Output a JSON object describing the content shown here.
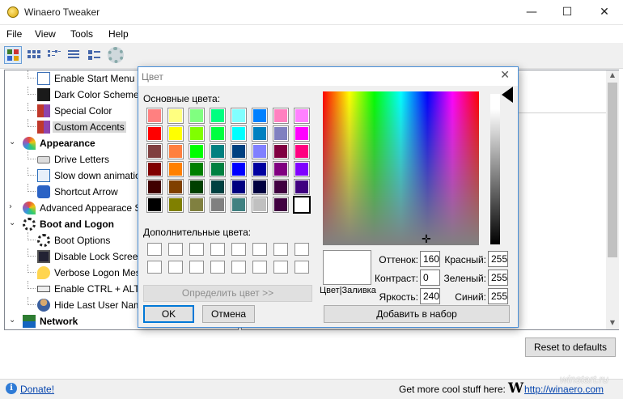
{
  "window": {
    "title": "Winaero Tweaker",
    "minimize_icon": "minimize-icon",
    "maximize_icon": "maximize-icon",
    "close_icon": "close-icon"
  },
  "menu": [
    "File",
    "View",
    "Tools",
    "Help"
  ],
  "tree": {
    "items": [
      {
        "label": "Enable Start Menu Jum",
        "icon": "checkbox-window-icon",
        "level": 2
      },
      {
        "label": "Dark Color Scheme",
        "icon": "dark-square-icon",
        "level": 2
      },
      {
        "label": "Special Color",
        "icon": "color-squares-icon",
        "level": 2
      },
      {
        "label": "Custom Accents",
        "icon": "color-squares-icon",
        "level": 2,
        "selected": true
      },
      {
        "label": "Appearance",
        "icon": "fan-icon",
        "level": 1,
        "bold": true,
        "expanded": true
      },
      {
        "label": "Drive Letters",
        "icon": "drive-icon",
        "level": 2
      },
      {
        "label": "Slow down animations",
        "icon": "window-icon",
        "level": 2
      },
      {
        "label": "Shortcut Arrow",
        "icon": "shortcut-arrow-icon",
        "level": 2
      },
      {
        "label": "Advanced Appearace Set",
        "icon": "fan-icon",
        "level": 1,
        "collapsed": true
      },
      {
        "label": "Boot and Logon",
        "icon": "spinner-icon",
        "level": 1,
        "bold": true,
        "expanded": true
      },
      {
        "label": "Boot Options",
        "icon": "spinner-icon",
        "level": 2
      },
      {
        "label": "Disable Lock Screen",
        "icon": "monitor-icon",
        "level": 2
      },
      {
        "label": "Verbose Logon Messa",
        "icon": "warning-bubble-icon",
        "level": 2
      },
      {
        "label": "Enable CTRL + ALT +",
        "icon": "keyboard-icon",
        "level": 2
      },
      {
        "label": "Hide Last User Name",
        "icon": "user-icon",
        "level": 2
      },
      {
        "label": "Network",
        "icon": "network-icon",
        "level": 1,
        "bold": true,
        "expanded": true
      }
    ]
  },
  "reset_button": "Reset to defaults",
  "status": {
    "donate": "Donate!",
    "promo": "Get more cool stuff here:",
    "logo": "W",
    "site": "http://winaero.com"
  },
  "watermark": "winstart.ru",
  "dialog": {
    "title": "Цвет",
    "basic_colors_label": "Основные цвета:",
    "custom_colors_label": "Дополнительные цвета:",
    "define_button": "Определить цвет >>",
    "ok_button": "OK",
    "cancel_button": "Отмена",
    "add_button": "Добавить в набор",
    "preview_label": "Цвет|Заливка",
    "basic_colors": [
      [
        "#ff8080",
        "#ffff80",
        "#80ff80",
        "#00ff80",
        "#80ffff",
        "#0080ff",
        "#ff80c0",
        "#ff80ff"
      ],
      [
        "#ff0000",
        "#ffff00",
        "#80ff00",
        "#00ff40",
        "#00ffff",
        "#0080c0",
        "#8080c0",
        "#ff00ff"
      ],
      [
        "#804040",
        "#ff8040",
        "#00ff00",
        "#008080",
        "#004080",
        "#8080ff",
        "#800040",
        "#ff0080"
      ],
      [
        "#800000",
        "#ff8000",
        "#008000",
        "#008040",
        "#0000ff",
        "#0000a0",
        "#800080",
        "#8000ff"
      ],
      [
        "#400000",
        "#804000",
        "#004000",
        "#004040",
        "#000080",
        "#000040",
        "#400040",
        "#400080"
      ],
      [
        "#000000",
        "#808000",
        "#808040",
        "#808080",
        "#408080",
        "#c0c0c0",
        "#400040",
        "#ffffff"
      ]
    ],
    "selected_swatch": "#ffffff",
    "fields": {
      "hue": {
        "label": "Оттенок:",
        "value": "160"
      },
      "sat": {
        "label": "Контраст:",
        "value": "0"
      },
      "lum": {
        "label": "Яркость:",
        "value": "240"
      },
      "red": {
        "label": "Красный:",
        "value": "255"
      },
      "green": {
        "label": "Зеленый:",
        "value": "255"
      },
      "blue": {
        "label": "Синий:",
        "value": "255"
      }
    }
  }
}
